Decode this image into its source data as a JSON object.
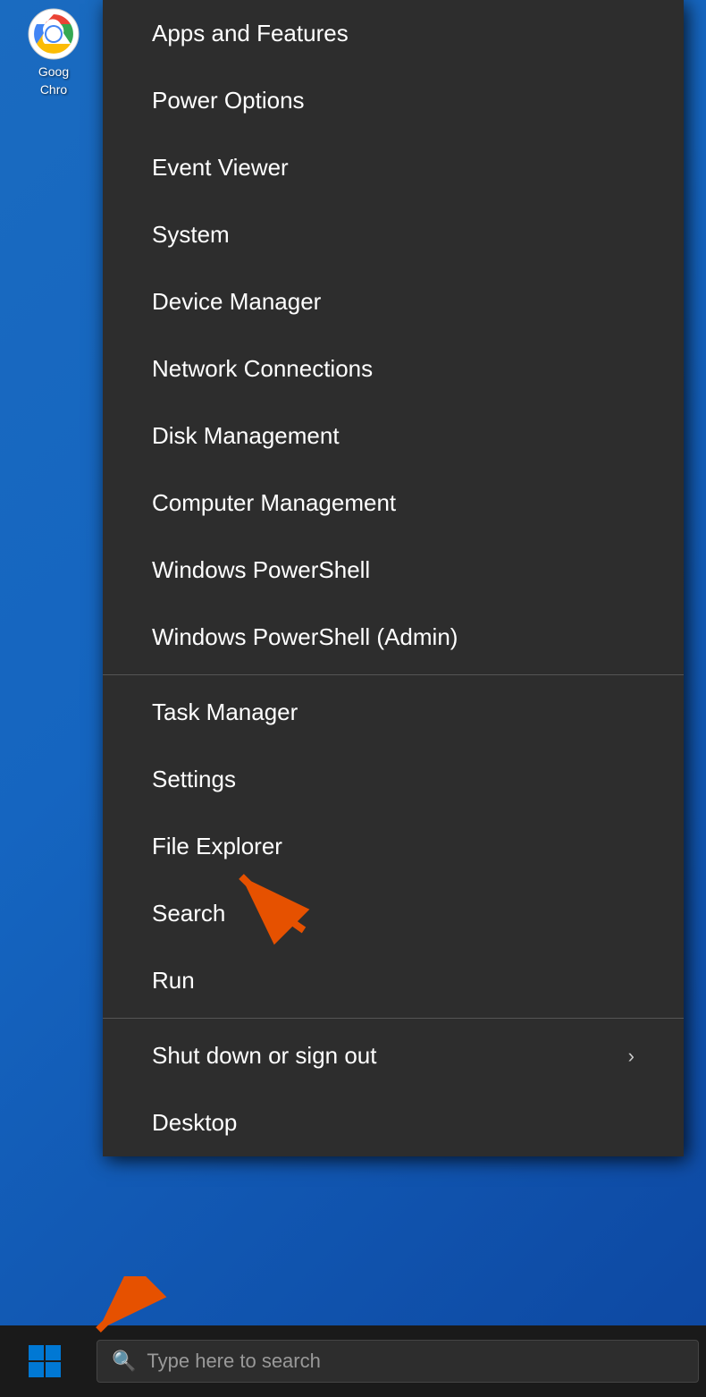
{
  "desktop": {
    "background_color": "#1565c0"
  },
  "chrome": {
    "label_line1": "Goog",
    "label_line2": "Chro"
  },
  "context_menu": {
    "items": [
      {
        "id": "apps-and-features",
        "label": "Apps and Features",
        "has_arrow": false,
        "has_divider_after": false
      },
      {
        "id": "power-options",
        "label": "Power Options",
        "has_arrow": false,
        "has_divider_after": false
      },
      {
        "id": "event-viewer",
        "label": "Event Viewer",
        "has_arrow": false,
        "has_divider_after": false
      },
      {
        "id": "system",
        "label": "System",
        "has_arrow": false,
        "has_divider_after": false
      },
      {
        "id": "device-manager",
        "label": "Device Manager",
        "has_arrow": false,
        "has_divider_after": false
      },
      {
        "id": "network-connections",
        "label": "Network Connections",
        "has_arrow": false,
        "has_divider_after": false
      },
      {
        "id": "disk-management",
        "label": "Disk Management",
        "has_arrow": false,
        "has_divider_after": false
      },
      {
        "id": "computer-management",
        "label": "Computer Management",
        "has_arrow": false,
        "has_divider_after": false
      },
      {
        "id": "windows-powershell",
        "label": "Windows PowerShell",
        "has_arrow": false,
        "has_divider_after": false
      },
      {
        "id": "windows-powershell-admin",
        "label": "Windows PowerShell (Admin)",
        "has_arrow": false,
        "has_divider_after": true
      },
      {
        "id": "task-manager",
        "label": "Task Manager",
        "has_arrow": false,
        "has_divider_after": false
      },
      {
        "id": "settings",
        "label": "Settings",
        "has_arrow": false,
        "has_divider_after": false
      },
      {
        "id": "file-explorer",
        "label": "File Explorer",
        "has_arrow": false,
        "has_divider_after": false
      },
      {
        "id": "search",
        "label": "Search",
        "has_arrow": false,
        "has_divider_after": false
      },
      {
        "id": "run",
        "label": "Run",
        "has_arrow": false,
        "has_divider_after": true
      },
      {
        "id": "shut-down-sign-out",
        "label": "Shut down or sign out",
        "has_arrow": true,
        "has_divider_after": false
      },
      {
        "id": "desktop",
        "label": "Desktop",
        "has_arrow": false,
        "has_divider_after": false
      }
    ],
    "arrow_label": "›"
  },
  "taskbar": {
    "search_placeholder": "Type here to search"
  }
}
